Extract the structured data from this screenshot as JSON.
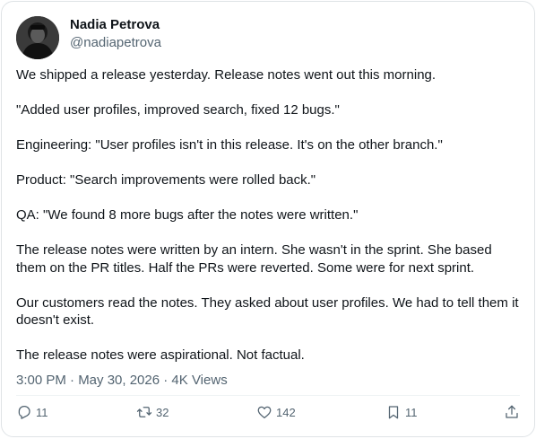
{
  "author": {
    "name": "Nadia Petrova",
    "handle": "@nadiapetrova",
    "avatar_icon": "user-avatar-photo"
  },
  "post": {
    "paragraphs": [
      "We shipped a release yesterday. Release notes went out this morning.",
      "\"Added user profiles, improved search, fixed 12 bugs.\"",
      "Engineering: \"User profiles isn't in this release. It's on the other branch.\"",
      "Product: \"Search improvements were rolled back.\"",
      "QA: \"We found 8 more bugs after the notes were written.\"",
      "The release notes were written by an intern. She wasn't in the sprint. She based them on the PR titles. Half the PRs were reverted. Some were for next sprint.",
      "Our customers read the notes. They asked about user profiles. We had to tell them it doesn't exist.",
      "The release notes were aspirational. Not factual."
    ],
    "timestamp": "3:00 PM · May 30, 2026 · ",
    "views_count": "4K",
    "views_label": " Views"
  },
  "actions": {
    "replies": {
      "icon": "reply-icon",
      "count": "11"
    },
    "retweets": {
      "icon": "retweet-icon",
      "count": "32"
    },
    "likes": {
      "icon": "heart-icon",
      "count": "142"
    },
    "bookmarks": {
      "icon": "bookmark-icon",
      "count": "11"
    },
    "share": {
      "icon": "share-icon"
    }
  },
  "colors": {
    "text": "#0f1419",
    "secondary": "#536471",
    "border": "#dfe3e6"
  }
}
